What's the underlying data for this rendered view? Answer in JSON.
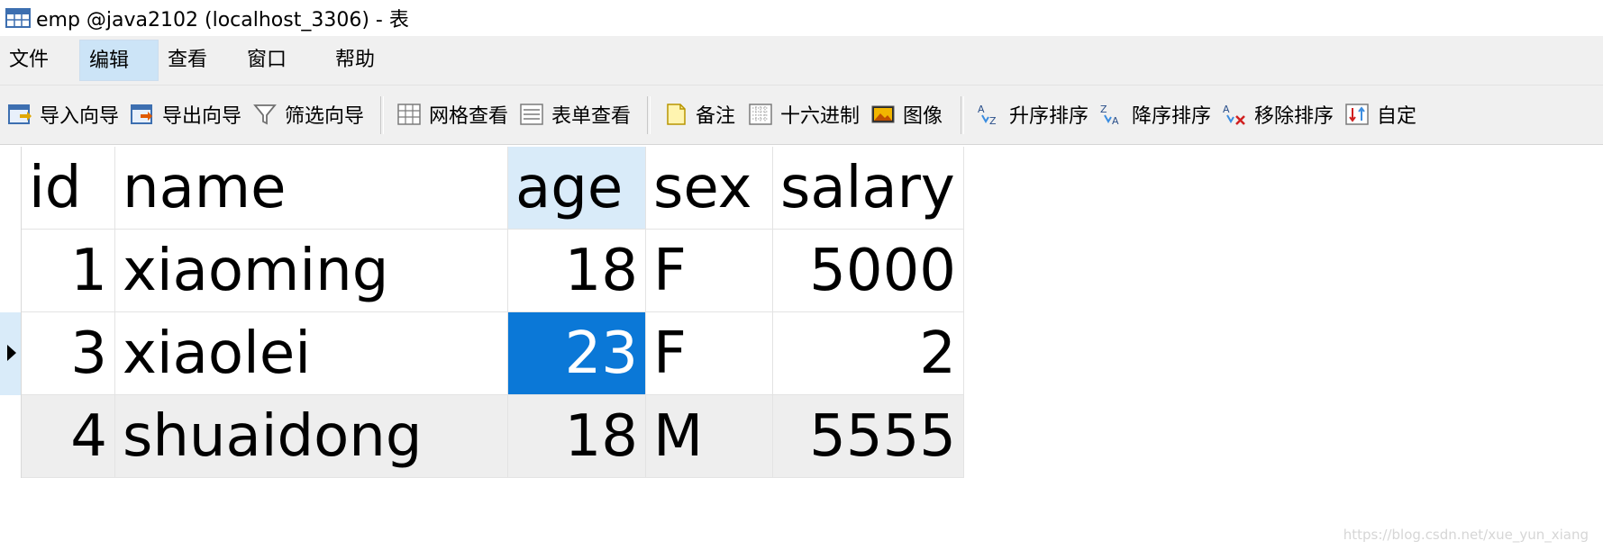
{
  "window": {
    "title": "emp @java2102 (localhost_3306) - 表"
  },
  "menu": {
    "items": [
      {
        "label": "文件"
      },
      {
        "label": "编辑"
      },
      {
        "label": "查看"
      },
      {
        "label": "窗口"
      },
      {
        "label": "帮助"
      }
    ],
    "active_index": 1
  },
  "toolbar": {
    "import_wizard": "导入向导",
    "export_wizard": "导出向导",
    "filter_wizard": "筛选向导",
    "grid_view": "网格查看",
    "form_view": "表单查看",
    "memo": "备注",
    "hex": "十六进制",
    "image": "图像",
    "sort_asc": "升序排序",
    "sort_desc": "降序排序",
    "remove_sort": "移除排序",
    "custom": "自定"
  },
  "table": {
    "columns": [
      "id",
      "name",
      "age",
      "sex",
      "salary"
    ],
    "selected_column": "age",
    "rows": [
      {
        "id": "1",
        "name": "xiaoming",
        "age": "18",
        "sex": "F",
        "salary": "5000"
      },
      {
        "id": "3",
        "name": "xiaolei",
        "age": "23",
        "sex": "F",
        "salary": "2"
      },
      {
        "id": "4",
        "name": "shuaidong",
        "age": "18",
        "sex": "M",
        "salary": "5555"
      }
    ],
    "current_row": 1,
    "selected_cell": {
      "row": 1,
      "column": "age"
    }
  },
  "colors": {
    "selection": "#0b78d7",
    "header_highlight": "#d9ebf9",
    "alt_row": "#eeeeee"
  },
  "watermark": "https://blog.csdn.net/xue_yun_xiang"
}
